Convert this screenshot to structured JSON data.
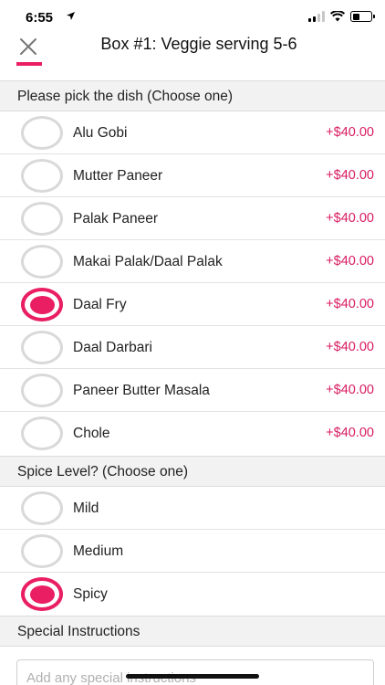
{
  "status_bar": {
    "time": "6:55"
  },
  "nav": {
    "title": "Box #1: Veggie serving 5-6"
  },
  "sections": {
    "dish": {
      "header": "Please pick the dish (Choose one)",
      "options": [
        {
          "label": "Alu Gobi",
          "price": "+$40.00",
          "selected": false
        },
        {
          "label": "Mutter Paneer",
          "price": "+$40.00",
          "selected": false
        },
        {
          "label": "Palak Paneer",
          "price": "+$40.00",
          "selected": false
        },
        {
          "label": "Makai Palak/Daal Palak",
          "price": "+$40.00",
          "selected": false
        },
        {
          "label": "Daal Fry",
          "price": "+$40.00",
          "selected": true
        },
        {
          "label": "Daal Darbari",
          "price": "+$40.00",
          "selected": false
        },
        {
          "label": "Paneer Butter Masala",
          "price": "+$40.00",
          "selected": false
        },
        {
          "label": "Chole",
          "price": "+$40.00",
          "selected": false
        }
      ]
    },
    "spice": {
      "header": "Spice Level? (Choose one)",
      "options": [
        {
          "label": "Mild",
          "selected": false
        },
        {
          "label": "Medium",
          "selected": false
        },
        {
          "label": "Spicy",
          "selected": true
        }
      ]
    },
    "instructions": {
      "header": "Special Instructions",
      "placeholder": "Add any special instructions",
      "value": ""
    }
  },
  "colors": {
    "accent": "#e91e63",
    "price": "#d81b60",
    "section_bg": "#f2f2f2"
  }
}
